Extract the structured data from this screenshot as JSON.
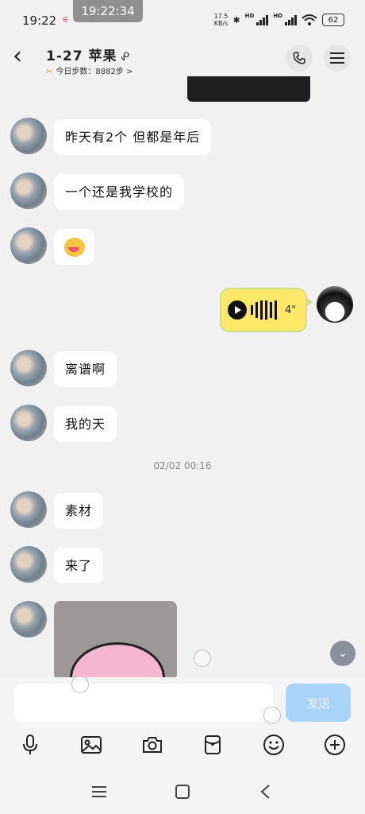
{
  "status": {
    "time": "19:22",
    "clock_overlay": "19:22:34",
    "mini": "⚟",
    "dots": "···",
    "net_speed_value": "17.5",
    "net_speed_unit": "KB/s",
    "hd1": "HD",
    "hd2": "HD",
    "battery": "62"
  },
  "header": {
    "title": "1-27 苹果",
    "ear_icon": "ear-icon",
    "subtitle_icon": "✂",
    "subtitle": "今日步数：8882步 >"
  },
  "messages": [
    {
      "text": "昨天有2个 但都是年后"
    },
    {
      "text": "一个还是我学校的"
    },
    {
      "type": "emoji",
      "icon": "laughing-emoji"
    },
    {
      "type": "voice",
      "duration": "4\""
    },
    {
      "text": "离谱啊"
    },
    {
      "text": "我的天"
    },
    {
      "text": "素材"
    },
    {
      "text": "来了"
    },
    {
      "type": "sticker"
    }
  ],
  "timestamp": "02/02 00:16",
  "input": {
    "value": "",
    "placeholder": "",
    "send_label": "发送"
  },
  "toolbar": [
    "microphone-icon",
    "image-icon",
    "camera-icon",
    "red-packet-icon",
    "emoji-icon",
    "plus-icon"
  ],
  "colors": {
    "background": "#f1f1f1",
    "voice_bubble": "#ffe868",
    "send_button": "#a9d4f7"
  }
}
